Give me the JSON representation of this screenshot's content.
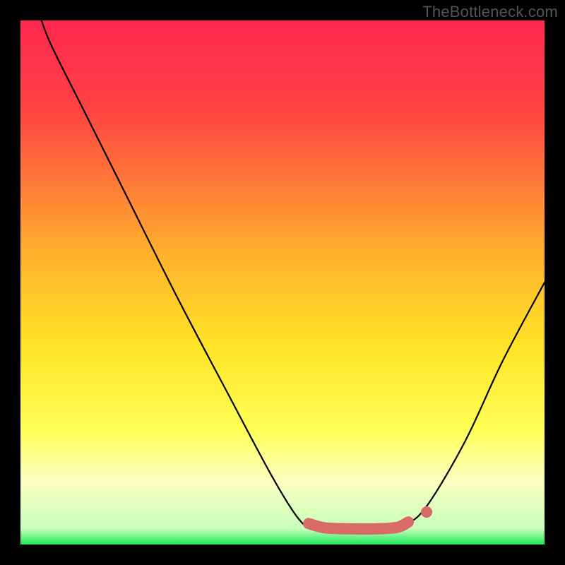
{
  "attribution": "TheBottleneck.com",
  "chart_data": {
    "type": "line",
    "title": "",
    "xlabel": "",
    "ylabel": "",
    "xlim": [
      0,
      100
    ],
    "ylim": [
      0,
      100
    ],
    "background_gradient_stops": [
      {
        "offset": 0,
        "color": "#ff2850"
      },
      {
        "offset": 0.17,
        "color": "#ff4343"
      },
      {
        "offset": 0.45,
        "color": "#ffb22c"
      },
      {
        "offset": 0.62,
        "color": "#ffe327"
      },
      {
        "offset": 0.78,
        "color": "#ffff55"
      },
      {
        "offset": 0.88,
        "color": "#faffc0"
      },
      {
        "offset": 0.97,
        "color": "#c8ffba"
      },
      {
        "offset": 1.0,
        "color": "#18e858"
      }
    ],
    "series": [
      {
        "name": "bottleneck-curve",
        "color": "#000000",
        "points": [
          {
            "x": 4.0,
            "y": 100.0
          },
          {
            "x": 6.0,
            "y": 95.0
          },
          {
            "x": 12.0,
            "y": 83.0
          },
          {
            "x": 20.0,
            "y": 67.0
          },
          {
            "x": 30.0,
            "y": 47.0
          },
          {
            "x": 40.0,
            "y": 28.0
          },
          {
            "x": 48.0,
            "y": 13.0
          },
          {
            "x": 53.0,
            "y": 5.0
          },
          {
            "x": 56.0,
            "y": 3.0
          },
          {
            "x": 62.0,
            "y": 2.8
          },
          {
            "x": 70.0,
            "y": 3.0
          },
          {
            "x": 74.0,
            "y": 4.0
          },
          {
            "x": 78.0,
            "y": 8.0
          },
          {
            "x": 85.0,
            "y": 20.0
          },
          {
            "x": 92.0,
            "y": 35.0
          },
          {
            "x": 100.0,
            "y": 50.0
          }
        ]
      },
      {
        "name": "sweet-zone-band",
        "color": "#d86a68",
        "points": [
          {
            "x": 55.0,
            "y": 4.0
          },
          {
            "x": 58.0,
            "y": 3.2
          },
          {
            "x": 63.0,
            "y": 3.0
          },
          {
            "x": 68.0,
            "y": 3.0
          },
          {
            "x": 72.0,
            "y": 3.3
          },
          {
            "x": 74.0,
            "y": 4.3
          }
        ],
        "stroke_width": 16
      },
      {
        "name": "sweet-zone-dot",
        "color": "#d86a68",
        "point": {
          "x": 77.5,
          "y": 6.2
        },
        "radius": 8
      }
    ]
  }
}
